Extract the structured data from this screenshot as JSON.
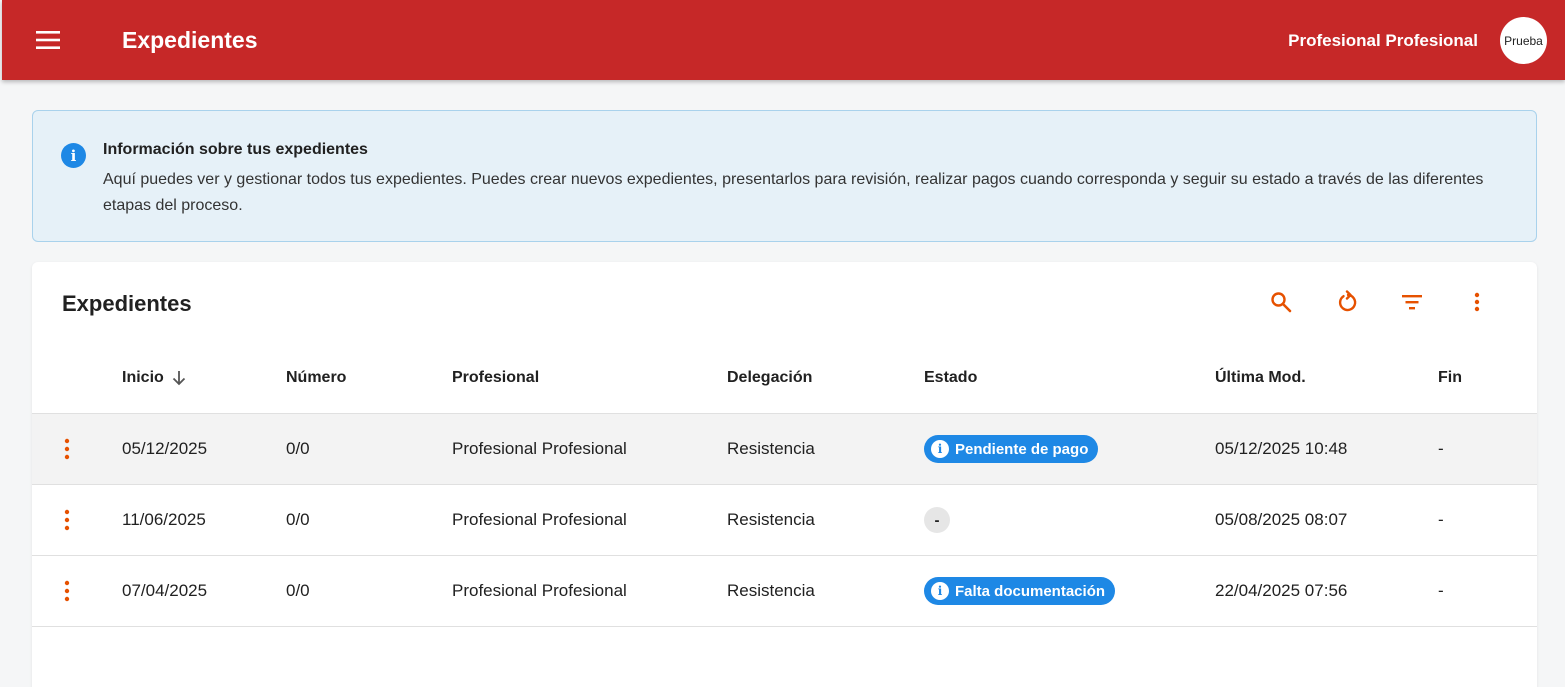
{
  "header": {
    "title": "Expedientes",
    "user_name": "Profesional Profesional",
    "avatar_label": "Prueba",
    "bg_color": "#c62828"
  },
  "info": {
    "title": "Información sobre tus expedientes",
    "text": "Aquí puedes ver y gestionar todos tus expedientes. Puedes crear nuevos expedientes, presentarlos para revisión, realizar pagos cuando corresponda y seguir su estado a través de las diferentes etapas del proceso."
  },
  "table": {
    "title": "Expedientes",
    "accent_color": "#e65100",
    "toolbar": [
      "search-icon",
      "refresh-icon",
      "filter-icon",
      "more-vert-icon"
    ],
    "columns": {
      "inicio": "Inicio",
      "numero": "Número",
      "profesional": "Profesional",
      "delegacion": "Delegación",
      "estado": "Estado",
      "ultima_mod": "Última Mod.",
      "fin": "Fin"
    },
    "sort": {
      "column": "Inicio",
      "direction": "desc"
    },
    "rows": [
      {
        "inicio": "05/12/2025",
        "numero": "0/0",
        "profesional": "Profesional Profesional",
        "delegacion": "Resistencia",
        "estado": "Pendiente de pago",
        "ultima_mod": "05/12/2025 10:48",
        "fin": "-"
      },
      {
        "inicio": "11/06/2025",
        "numero": "0/0",
        "profesional": "Profesional Profesional",
        "delegacion": "Resistencia",
        "estado": "-",
        "ultima_mod": "05/08/2025 08:07",
        "fin": "-"
      },
      {
        "inicio": "07/04/2025",
        "numero": "0/0",
        "profesional": "Profesional Profesional",
        "delegacion": "Resistencia",
        "estado": "Falta documentación",
        "ultima_mod": "22/04/2025 07:56",
        "fin": "-"
      }
    ]
  }
}
